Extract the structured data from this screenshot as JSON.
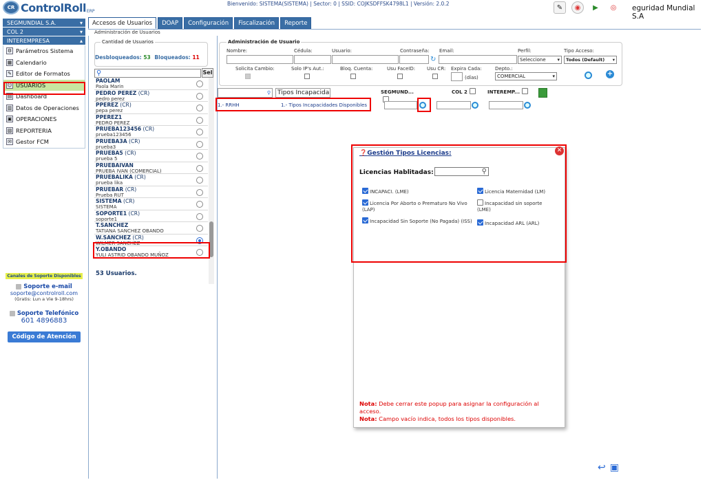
{
  "app": {
    "logo_text": "ControlRoll",
    "logo_sub": "ERP",
    "logo_badge": "CR"
  },
  "header": {
    "info": "Bienvenido: SISTEMA(SISTEMA)  | Sector: 0 | SSID: COJKSDFFSK4798L1 | Versión: 2.0.2",
    "brand": "eguridad Mundial S.A"
  },
  "sidebar": {
    "companies": [
      "SEGMUNDIAL S.A.",
      "COL 2",
      "INTEREMPRESA"
    ],
    "items": [
      {
        "label": "Parámetros Sistema",
        "icon": "settings-icon"
      },
      {
        "label": "Calendario",
        "icon": "calendar-icon"
      },
      {
        "label": "Editor de Formatos",
        "icon": "format-editor-icon"
      },
      {
        "label": "USUARIOS",
        "icon": "users-icon",
        "selected": true
      },
      {
        "label": "Dashboard",
        "icon": "dashboard-icon"
      },
      {
        "label": "Datos de Operaciones",
        "icon": "data-icon"
      },
      {
        "label": "OPERACIONES",
        "icon": "operations-icon"
      },
      {
        "label": "REPORTERIA",
        "icon": "report-icon"
      },
      {
        "label": "Gestor FCM",
        "icon": "fcm-icon"
      }
    ]
  },
  "support": {
    "chip": "Canales de Soporte Disponibles",
    "email_title": "Soporte e-mail",
    "email": "soporte@controlroll.com",
    "hours": "(Gratis: Lun a Vie 9-18hrs)",
    "phone_title": "Soporte Telefónico",
    "phone": "601 4896883",
    "button": "Código de Atención"
  },
  "tabs": [
    "Accesos de Usuarios",
    "DOAP",
    "Configuración",
    "Fiscalización",
    "Reporte"
  ],
  "breadcrumb": "Administración de Usuarios",
  "users_panel": {
    "legend": "Cantidad de Usuarios",
    "unlocked_label": "Desbloqueados:",
    "unlocked": "53",
    "locked_label": "Bloqueados:",
    "locked": "11",
    "search_btn": "Sel",
    "count": "53 Usuarios.",
    "users": [
      {
        "n": "PAOLAM",
        "c": "",
        "s": "Paola Marin"
      },
      {
        "n": "PEDRO PEREZ",
        "c": " (CR)",
        "s": "pedro perez"
      },
      {
        "n": "PPEREZ",
        "c": " (CR)",
        "s": "pepa perez"
      },
      {
        "n": "PPEREZ1",
        "c": "",
        "s": "PEDRO PEREZ"
      },
      {
        "n": "PRUEBA123456",
        "c": " (CR)",
        "s": "prueba123456"
      },
      {
        "n": "PRUEBA3A",
        "c": " (CR)",
        "s": "prueba3"
      },
      {
        "n": "PRUEBA5",
        "c": " (CR)",
        "s": "prueba 5"
      },
      {
        "n": "PRUEBAIVAN",
        "c": "",
        "s": "PRUEBA IVAN (COMERCIAL)"
      },
      {
        "n": "PRUEBALIKA",
        "c": " (CR)",
        "s": "prueba lika"
      },
      {
        "n": "PRUEBAR",
        "c": " (CR)",
        "s": "Prueba RUT"
      },
      {
        "n": "SISTEMA",
        "c": " (CR)",
        "s": "SISTEMA"
      },
      {
        "n": "SOPORTE1",
        "c": " (CR)",
        "s": "soporte1"
      },
      {
        "n": "T.SANCHEZ",
        "c": "",
        "s": "TATIANA SANCHEZ OBANDO"
      },
      {
        "n": "W.SANCHEZ",
        "c": " (CR)",
        "s": "WILMER SANCHEZ",
        "sel": true
      },
      {
        "n": "Y.OBANDO",
        "c": "",
        "s": "YULI ASTRID OBANDO MUÑOZ"
      }
    ]
  },
  "admin": {
    "legend": "Administración de Usuario",
    "nombre": "Nombre:",
    "cedula": "Cédula:",
    "usuario": "Usuario:",
    "contrasena": "Contraseña:",
    "email": "Email:",
    "perfil": "Perfil:",
    "perfil_val": "Seleccione",
    "tipo_acceso": "Tipo Acceso:",
    "tipo_val": "Todos (Default)",
    "solicita": "Solicita Cambio:",
    "ips": "Solo IP's Aut.:",
    "bloq": "Bloq. Cuenta:",
    "faceid": "Usu FaceID:",
    "cr": "Usu CR:",
    "expira": "Expira Cada:",
    "dias": "(días)",
    "depto": "Depto.:",
    "depto_val": "COMERCIAL"
  },
  "grid": {
    "col_tipos": "Tipos Incapacida",
    "col_seg": "SEGMUND...",
    "col_col2": "COL 2",
    "col_inter": "INTEREMP...",
    "row_label": "1.- RRHH",
    "row_desc": "1.- Tipos Incapacidades Disponibles"
  },
  "popup": {
    "title": "Gestión Tipos Licencias:",
    "habilitadas": "Licencias Hablitadas:",
    "licenses": [
      {
        "label": "INCAPACI. (LME)",
        "checked": true
      },
      {
        "label": "Licencia Maternidad (LM)",
        "checked": true
      },
      {
        "label": "Licencia Por Aborto o Prematuro No Vivo (LAP)",
        "checked": true
      },
      {
        "label": "Incapacidad sin soporte (LME)",
        "checked": false
      },
      {
        "label": "Incapacidad Sin Soporte (No Pagada) (ISS)",
        "checked": true
      },
      {
        "label": "Incapacidad ARL (ARL)",
        "checked": true
      }
    ],
    "note_label": "Nota:",
    "note1": " Debe cerrar este popup para asignar la configuración al acceso.",
    "note2": " Campo vacío indica, todos los tipos disponibles."
  }
}
